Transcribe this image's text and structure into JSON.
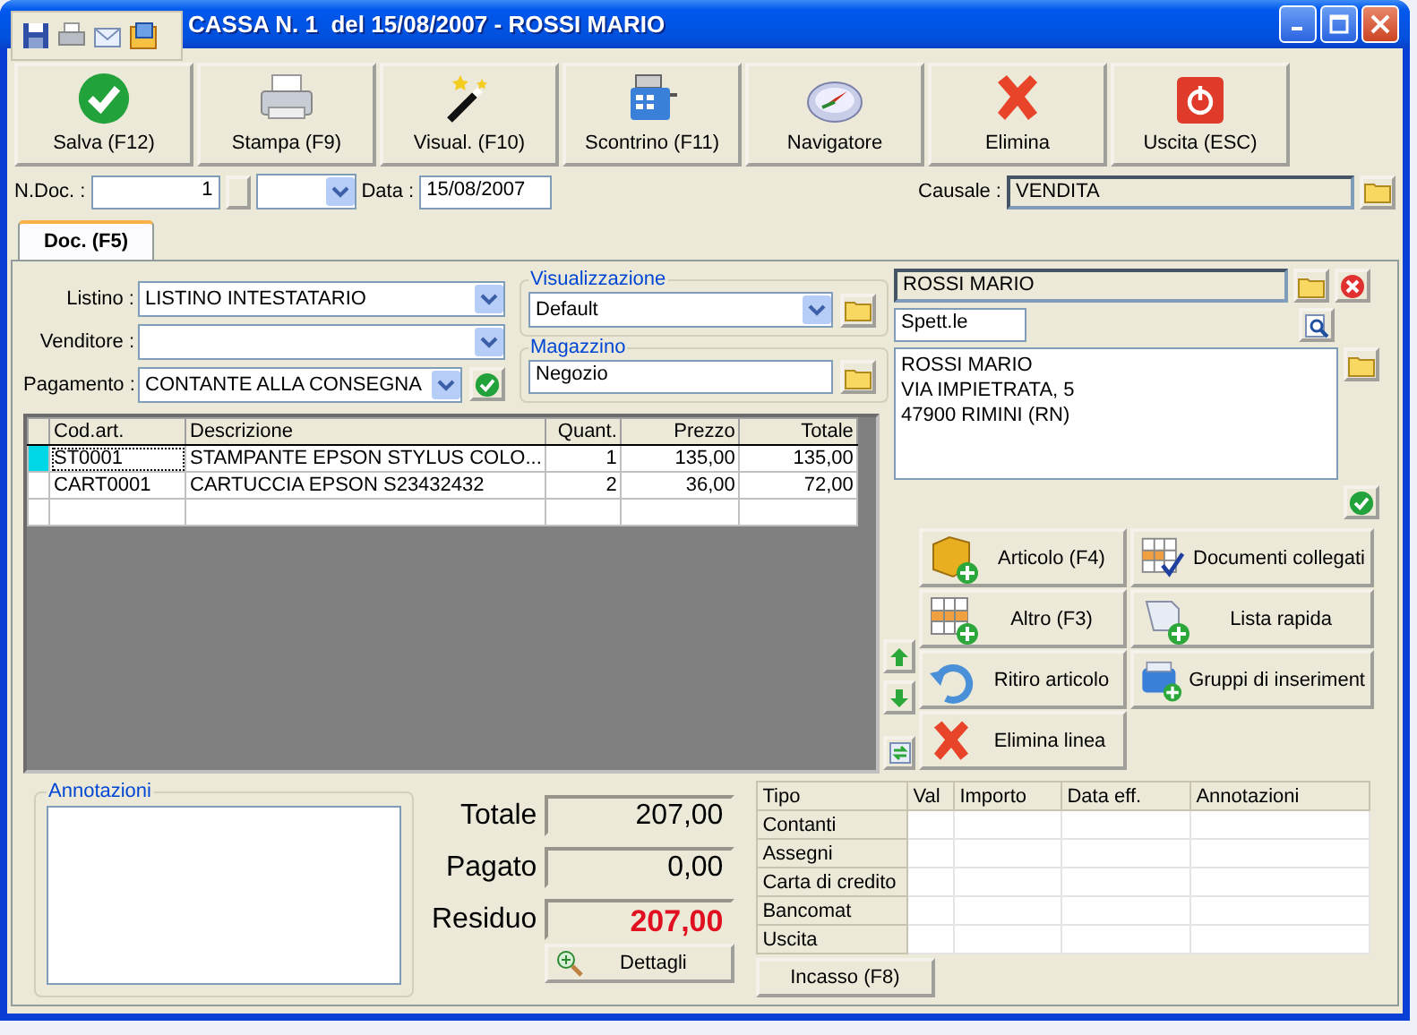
{
  "window": {
    "title": "CASSA N. 1  del 15/08/2007 - ROSSI MARIO"
  },
  "quick_toolbar": [
    {
      "kind": "save"
    },
    {
      "kind": "print"
    },
    {
      "kind": "mail"
    },
    {
      "kind": "window"
    }
  ],
  "toolbar": [
    {
      "label": "Salva (F12)",
      "kind": "check"
    },
    {
      "label": "Stampa (F9)",
      "kind": "printer"
    },
    {
      "label": "Visual. (F10)",
      "kind": "wand"
    },
    {
      "label": "Scontrino (F11)",
      "kind": "register"
    },
    {
      "label": "Navigatore",
      "kind": "compass"
    },
    {
      "label": "Elimina",
      "kind": "cross"
    },
    {
      "label": "Uscita (ESC)",
      "kind": "power"
    }
  ],
  "header": {
    "ndoc_label": "N.Doc. :",
    "ndoc_value": "1",
    "data_label": "Data :",
    "data_value": "15/08/2007",
    "causale_label": "Causale :",
    "causale_value": "VENDITA"
  },
  "tabs": [
    {
      "label": "Doc. (F5)",
      "selected": true
    }
  ],
  "form": [
    {
      "label": "Listino :",
      "value": "LISTINO INTESTATARIO",
      "kind": "select"
    },
    {
      "label": "Venditore :",
      "kind": "select"
    },
    {
      "label": "Pagamento :",
      "value": "CONTANTE ALLA CONSEGNA",
      "kind": "select_confirm"
    }
  ],
  "visualizzazione": {
    "title": "Visualizzazione",
    "value": "Default"
  },
  "magazzino": {
    "title": "Magazzino",
    "value": "Negozio"
  },
  "grid": {
    "columns": [
      "Cod.art.",
      "Descrizione",
      "Quant.",
      "Prezzo",
      "Totale"
    ],
    "rows": [
      {
        "selected": true,
        "cells": [
          "ST0001",
          "STAMPANTE EPSON STYLUS COLO...",
          "1",
          "135,00",
          "135,00"
        ]
      },
      {
        "selected": false,
        "cells": [
          "CART0001",
          "CARTUCCIA EPSON S23432432",
          "2",
          "36,00",
          "72,00"
        ]
      }
    ]
  },
  "customer": {
    "name": "ROSSI MARIO",
    "salutation": "Spett.le",
    "address": [
      "ROSSI MARIO",
      "VIA IMPIETRATA, 5",
      "47900 RIMINI (RN)"
    ]
  },
  "actions": [
    {
      "label": "Articolo (F4)",
      "kind": "cube"
    },
    {
      "label": "Documenti collegati",
      "kind": "gridcheck"
    },
    {
      "label": "Altro (F3)",
      "kind": "gridplus"
    },
    {
      "label": "Lista rapida",
      "kind": "scroll"
    },
    {
      "label": "Ritiro articolo",
      "kind": "undo"
    },
    {
      "label": "Gruppi di inseriment",
      "kind": "box"
    },
    {
      "label": "Elimina linea",
      "kind": "cross"
    }
  ],
  "annotations": {
    "title": "Annotazioni"
  },
  "totals": [
    {
      "label": "Totale",
      "value": "207,00",
      "kind": "plain"
    },
    {
      "label": "Pagato",
      "value": "0,00",
      "kind": "plain"
    },
    {
      "label": "Residuo",
      "value": "207,00",
      "kind": "due"
    }
  ],
  "details_button": "Dettagli",
  "payments": {
    "columns": [
      "Tipo",
      "Val",
      "Importo",
      "Data eff.",
      "Annotazioni"
    ],
    "rows": [
      "Contanti",
      "Assegni",
      "Carta di credito",
      "Bancomat",
      "Uscita"
    ]
  },
  "collect_button": "Incasso (F8)"
}
